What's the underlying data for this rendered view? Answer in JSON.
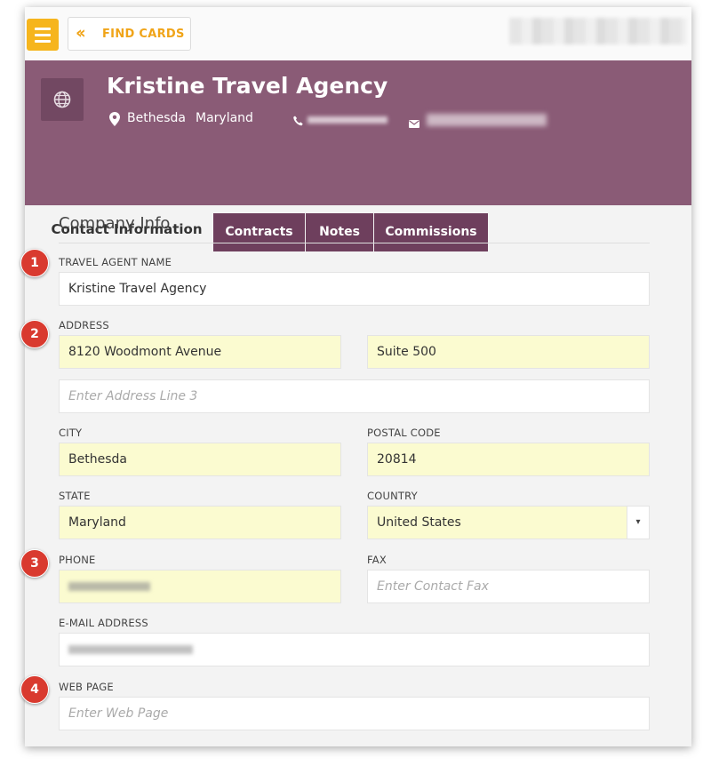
{
  "topbar": {
    "find_cards_label": "FIND CARDS",
    "find_cards_icon": "chevrons-left-icon",
    "menu_icon": "hamburger-menu-icon"
  },
  "header": {
    "agency_name": "Kristine Travel Agency",
    "city": "Bethesda",
    "state": "Maryland"
  },
  "tabs": [
    {
      "label": "Contact Information",
      "active": true
    },
    {
      "label": "Contracts",
      "active": false
    },
    {
      "label": "Notes",
      "active": false
    },
    {
      "label": "Commissions",
      "active": false
    }
  ],
  "section": {
    "title": "Company Info"
  },
  "form": {
    "agent_name_label": "TRAVEL AGENT NAME",
    "agent_name_value": "Kristine Travel Agency",
    "address_label": "ADDRESS",
    "address1_value": "8120 Woodmont Avenue",
    "address2_value": "Suite 500",
    "address3_placeholder": "Enter Address Line 3",
    "city_label": "CITY",
    "city_value": "Bethesda",
    "postal_label": "POSTAL CODE",
    "postal_value": "20814",
    "state_label": "STATE",
    "state_value": "Maryland",
    "country_label": "COUNTRY",
    "country_value": "United States",
    "phone_label": "PHONE",
    "fax_label": "FAX",
    "fax_placeholder": "Enter Contact Fax",
    "email_label": "E-MAIL ADDRESS",
    "web_label": "WEB PAGE",
    "web_placeholder": "Enter Web Page"
  },
  "callouts": [
    "1",
    "2",
    "3",
    "4"
  ],
  "colors": {
    "header_bg": "#8a5b76",
    "tab_bg": "#6e3f5d",
    "accent": "#f6b51d",
    "filled_field": "#fbfbd0",
    "callout": "#d93a2f"
  }
}
